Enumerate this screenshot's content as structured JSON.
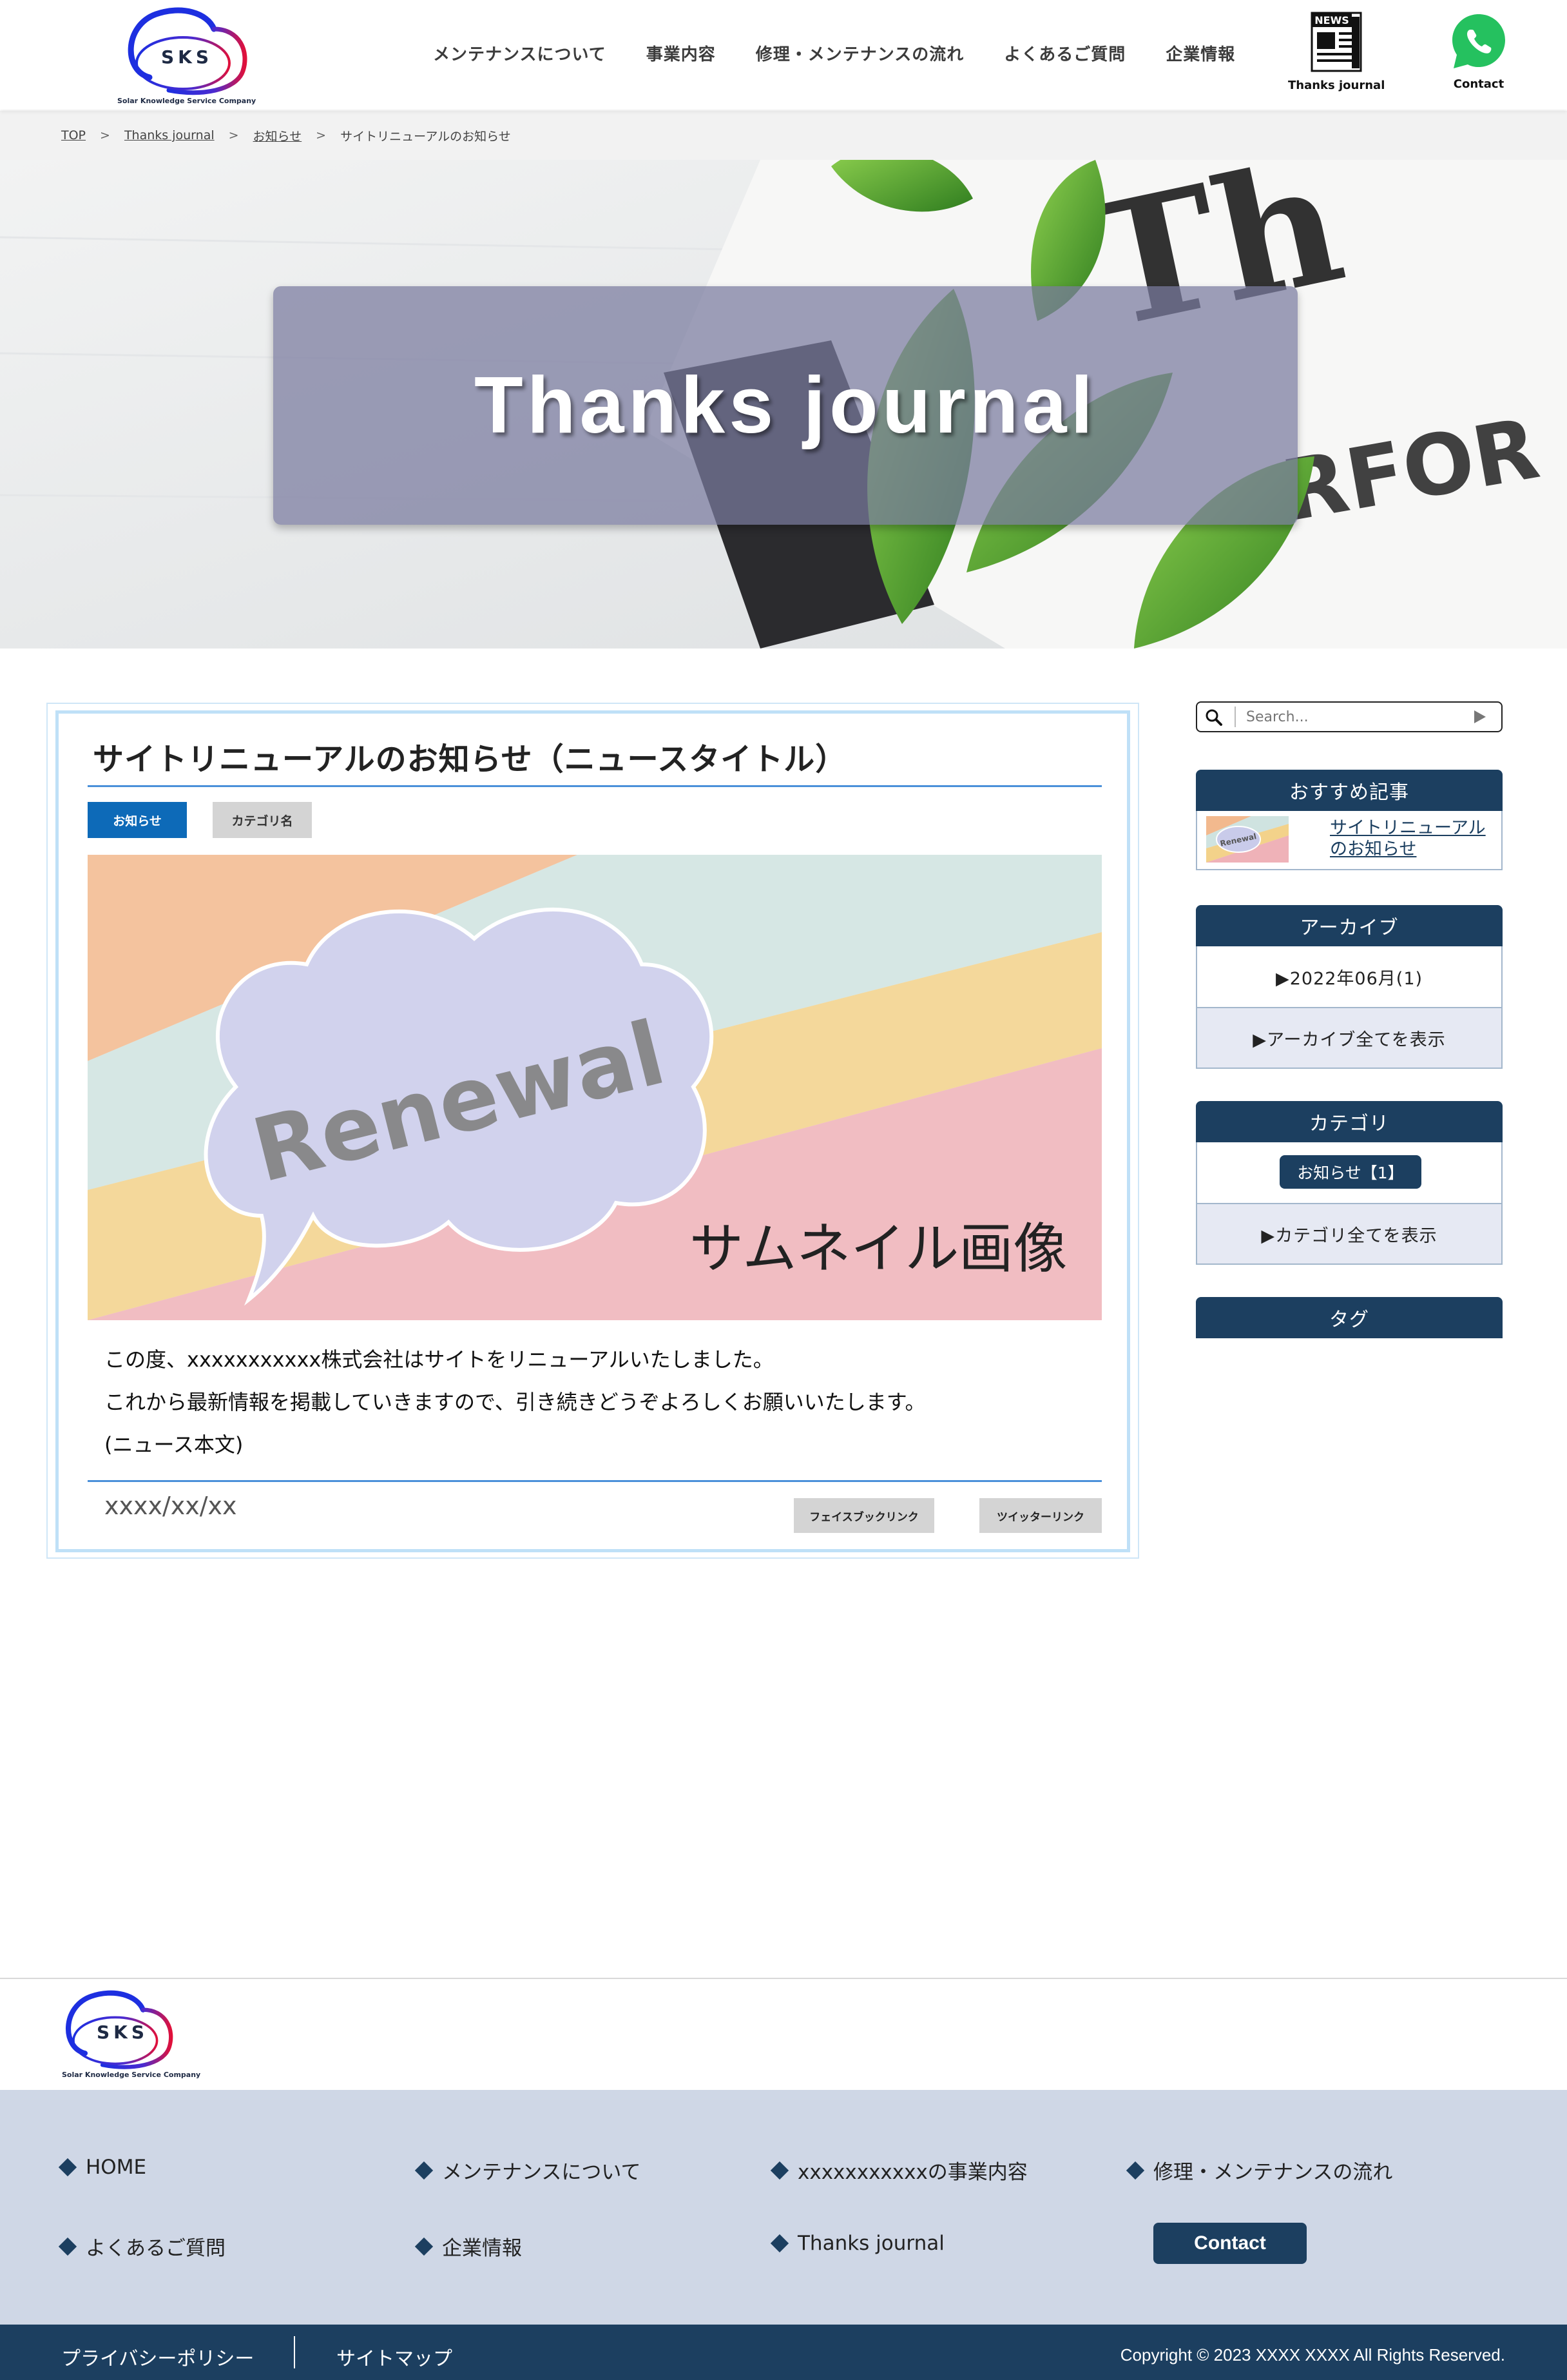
{
  "colors": {
    "brand_navy": "#1c3f60",
    "accent_blue": "#0d6ab8",
    "rule_blue": "#4a90d9",
    "footer_bg": "#cfd7e6",
    "breadcrumb_bg": "#f2f2f2"
  },
  "header": {
    "logo": {
      "text": "SKS",
      "subtitle": "Solar Knowledge Service Company"
    },
    "nav": [
      {
        "label": "メンテナンスについて"
      },
      {
        "label": "事業内容"
      },
      {
        "label": "修理・メンテナンスの流れ"
      },
      {
        "label": "よくあるご質問"
      },
      {
        "label": "企業情報"
      }
    ],
    "news_icon": {
      "badge": "NEWS",
      "label": "Thanks journal",
      "icon": "newspaper-icon"
    },
    "contact_icon": {
      "label": "Contact",
      "icon": "whatsapp-icon"
    }
  },
  "breadcrumb": {
    "items": [
      "TOP",
      "Thanks journal",
      "お知らせ"
    ],
    "current": "サイトリニューアルのお知らせ",
    "separator": ">"
  },
  "hero": {
    "title": "Thanks journal"
  },
  "article": {
    "title": "サイトリニューアルのお知らせ（ニュースタイトル）",
    "tags": [
      "お知らせ",
      "カテゴリ名"
    ],
    "thumbnail": {
      "badge_text": "Renewal",
      "caption": "サムネイル画像"
    },
    "body": [
      "この度、xxxxxxxxxxx株式会社はサイトをリニューアルいたしました。",
      "これから最新情報を掲載していきますので、引き続きどうぞよろしくお願いいたします。",
      "(ニュース本文)"
    ],
    "date": "xxxx/xx/xx",
    "share": [
      "フェイスブックリンク",
      "ツイッターリンク"
    ]
  },
  "sidebar": {
    "search": {
      "placeholder": "Search..."
    },
    "recommended": {
      "heading": "おすすめ記事",
      "link_line1": "サイトリニューアル",
      "link_line2": "のお知らせ"
    },
    "archive": {
      "heading": "アーカイブ",
      "item": "▶2022年06月(1)",
      "view_all": "▶アーカイブ全てを表示"
    },
    "category": {
      "heading": "カテゴリ",
      "item": "お知らせ【1】",
      "view_all": "▶カテゴリ全てを表示"
    },
    "tags": {
      "heading": "タグ"
    }
  },
  "footer": {
    "logo": {
      "text": "SKS",
      "subtitle": "Solar Knowledge Service Company"
    },
    "links": [
      "HOME",
      "メンテナンスについて",
      "xxxxxxxxxxxの事業内容",
      "修理・メンテナンスの流れ",
      "よくあるご質問",
      "企業情報",
      "Thanks journal"
    ],
    "contact_button": "Contact",
    "privacy": "プライバシーポリシー",
    "sitemap": "サイトマップ",
    "copyright": "Copyright © 2023 XXXX XXXX All Rights Reserved."
  }
}
